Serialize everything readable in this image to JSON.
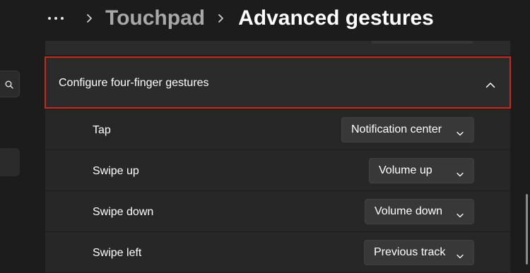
{
  "breadcrumb": {
    "parent": "Touchpad",
    "current": "Advanced gestures"
  },
  "expander": {
    "title": "Configure four-finger gestures",
    "expanded": true,
    "highlight_color": "#c42b1c"
  },
  "gestures": [
    {
      "label": "Tap",
      "value": "Notification center"
    },
    {
      "label": "Swipe up",
      "value": "Volume up"
    },
    {
      "label": "Swipe down",
      "value": "Volume down"
    },
    {
      "label": "Swipe left",
      "value": "Previous track"
    }
  ],
  "icons": {
    "more": "more-horizontal-icon",
    "separator": "chevron-right-icon",
    "collapse": "chevron-up-icon",
    "dropdown": "chevron-down-icon",
    "search": "search-icon"
  }
}
